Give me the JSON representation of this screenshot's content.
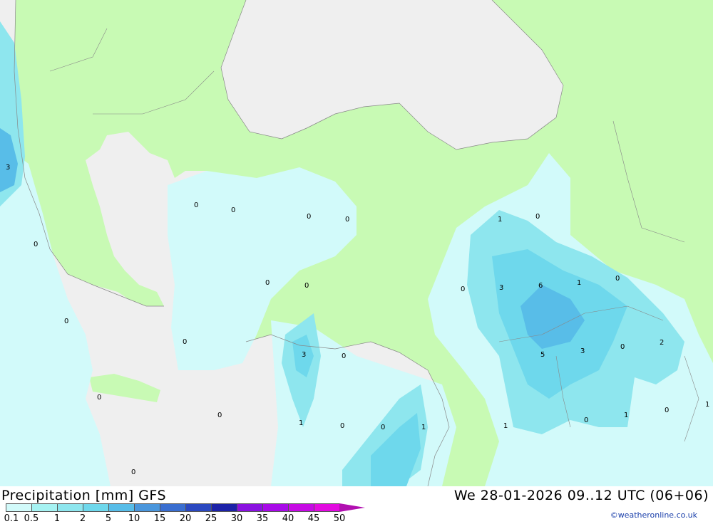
{
  "header": {
    "title": "Precipitation [mm] GFS",
    "time": "We 28-01-2026 09..12 UTC (06+06)"
  },
  "credit": "©weatheronline.co.uk",
  "colors": {
    "sea": "#efefef",
    "land_dry": "#c8fab4",
    "precip": [
      "#d2fafa",
      "#a6f2f2",
      "#8ee6ee",
      "#6ed8ec",
      "#58bde8",
      "#4a96dc",
      "#3a6ed0",
      "#2b48c0",
      "#1c22a8",
      "#8a12e0",
      "#a80ae8",
      "#c60ae4",
      "#e20ae0",
      "#b10fb0"
    ]
  },
  "legend": {
    "ticks": [
      "0.1",
      "0.5",
      "1",
      "2",
      "5",
      "10",
      "15",
      "20",
      "25",
      "30",
      "35",
      "40",
      "45",
      "50"
    ]
  },
  "map_values": [
    "3",
    "0",
    "0",
    "0",
    "0",
    "0",
    "1",
    "0",
    "0",
    "0",
    "0",
    "0",
    "3",
    "6",
    "1",
    "0",
    "3",
    "0",
    "0",
    "3",
    "5",
    "0",
    "2",
    "0",
    "0",
    "1",
    "0",
    "1",
    "0",
    "1",
    "1",
    "0",
    "1",
    "0",
    "0"
  ]
}
